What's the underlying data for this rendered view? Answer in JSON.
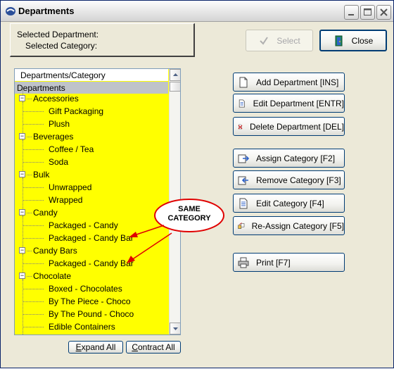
{
  "window": {
    "title": "Departments"
  },
  "selection": {
    "department_label": "Selected Department:",
    "category_label": "Selected Category:"
  },
  "top_buttons": {
    "select_label": "Select",
    "close_label": "Close"
  },
  "tree": {
    "header": "Departments/Category",
    "root": "Departments",
    "groups": [
      {
        "label": "Accessories",
        "children": [
          "Gift Packaging",
          "Plush"
        ]
      },
      {
        "label": "Beverages",
        "children": [
          "Coffee / Tea",
          "Soda"
        ]
      },
      {
        "label": "Bulk",
        "children": [
          "Unwrapped",
          "Wrapped"
        ]
      },
      {
        "label": "Candy",
        "children": [
          "Packaged - Candy",
          "Packaged - Candy Bar"
        ]
      },
      {
        "label": "Candy Bars",
        "children": [
          "Packaged - Candy Bar"
        ]
      },
      {
        "label": "Chocolate",
        "children": [
          "Boxed - Chocolates",
          "By The Piece - Choco",
          "By The Pound - Choco",
          "Edible Containers"
        ]
      }
    ],
    "expander_symbol": "−"
  },
  "bottom_buttons": {
    "expand_all": "Expand All",
    "contract_all": "Contract All"
  },
  "actions": {
    "add_department": "Add Department [INS]",
    "edit_department": "Edit Department [ENTR]",
    "delete_department": "Delete Department [DEL]",
    "assign_category": "Assign Category [F2]",
    "remove_category": "Remove Category [F3]",
    "edit_category": "Edit Category [F4]",
    "reassign_category": "Re-Assign Category [F5]",
    "print": "Print [F7]"
  },
  "annotation": {
    "line1": "SAME",
    "line2": "CATEGORY"
  },
  "colors": {
    "tree_background": "#ffff00",
    "annotation_red": "#e00000",
    "button_border": "#003c74"
  }
}
